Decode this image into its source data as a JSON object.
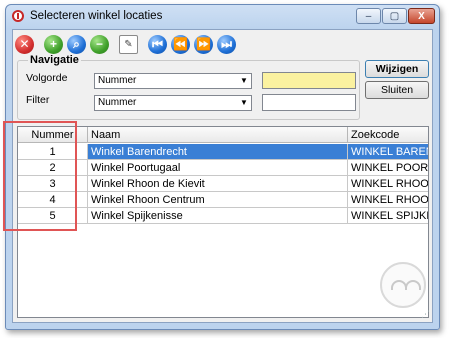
{
  "window": {
    "title": "Selecteren winkel locaties"
  },
  "caption_buttons": {
    "minimize": "–",
    "maximize": "▢",
    "close": "X"
  },
  "toolbar": [
    {
      "name": "delete-icon",
      "glyph": "✕",
      "color": "red"
    },
    {
      "name": "add-icon",
      "glyph": "+",
      "color": "green"
    },
    {
      "name": "search-icon",
      "glyph": "⌕",
      "color": "blue"
    },
    {
      "name": "remove-icon",
      "glyph": "−",
      "color": "green"
    },
    {
      "name": "clipboard-icon",
      "glyph": "✎",
      "color": "doc"
    },
    {
      "name": "first-record-icon",
      "glyph": "⏮",
      "color": "blue"
    },
    {
      "name": "previous-record-icon",
      "glyph": "⏪",
      "color": "blue"
    },
    {
      "name": "next-record-icon",
      "glyph": "⏩",
      "color": "blue"
    },
    {
      "name": "last-record-icon",
      "glyph": "⏭",
      "color": "blue"
    }
  ],
  "navigatie": {
    "title": "Navigatie",
    "volgorde_label": "Volgorde",
    "volgorde_value": "Nummer",
    "filter_label": "Filter",
    "filter_value": "Nummer"
  },
  "buttons": {
    "wijzigen": "Wijzigen",
    "sluiten": "Sluiten"
  },
  "grid": {
    "columns": [
      "Nummer",
      "Naam",
      "Zoekcode"
    ],
    "rows": [
      {
        "nummer": "1",
        "naam": "Winkel Barendrecht",
        "zoekcode": "WINKEL BAREND"
      },
      {
        "nummer": "2",
        "naam": "Winkel Poortugaal",
        "zoekcode": "WINKEL POORTU"
      },
      {
        "nummer": "3",
        "naam": "Winkel Rhoon de Kievit",
        "zoekcode": "WINKEL RHOON"
      },
      {
        "nummer": "4",
        "naam": "Winkel Rhoon Centrum",
        "zoekcode": "WINKEL RHOON"
      },
      {
        "nummer": "5",
        "naam": "Winkel Spijkenisse",
        "zoekcode": "WINKEL SPIJKEN"
      }
    ],
    "selected_index": 0
  }
}
